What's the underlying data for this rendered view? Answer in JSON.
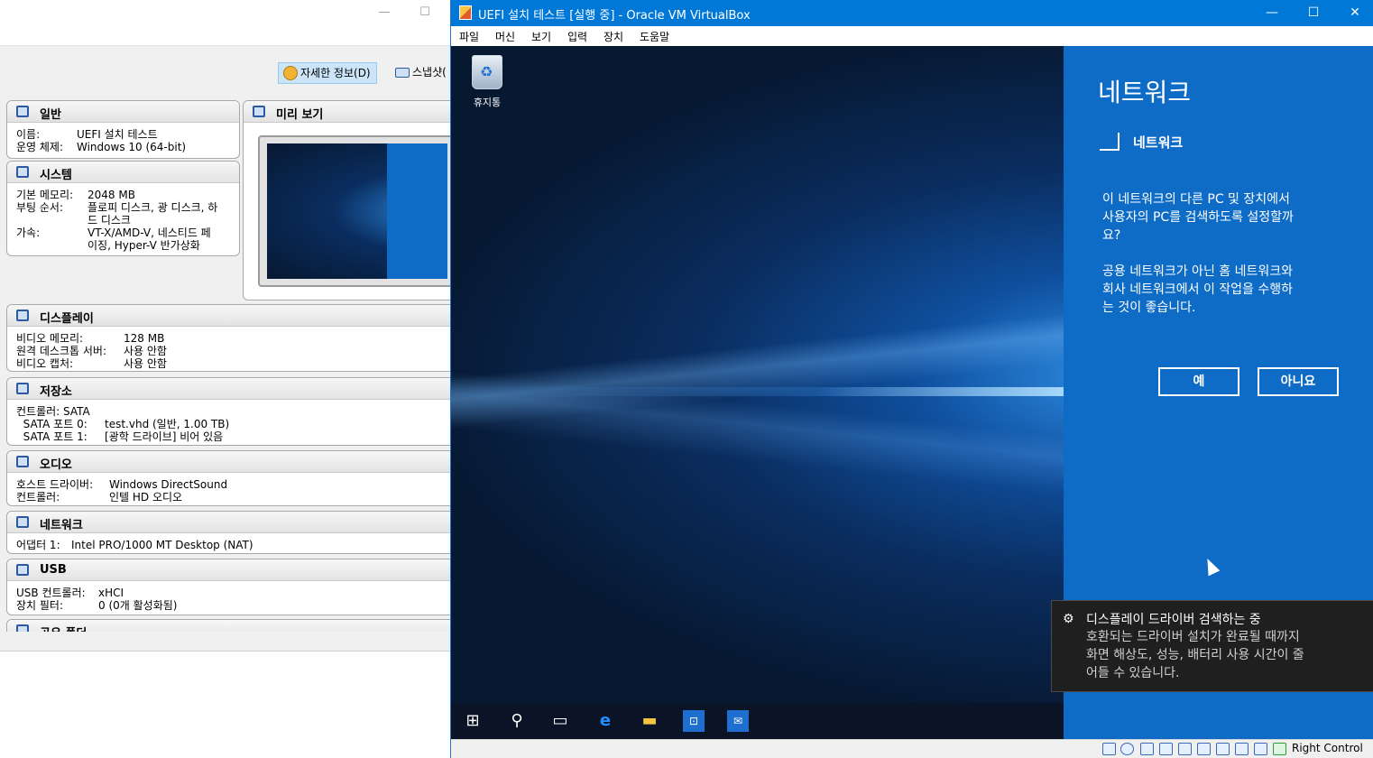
{
  "manager": {
    "toolbar": {
      "details_label": "자세한 정보(D)",
      "snapshots_label": "스냅샷("
    },
    "general": {
      "title": "일반",
      "rows": [
        {
          "k": "이름:",
          "v": "UEFI 설치 테스트"
        },
        {
          "k": "운영 체제:",
          "v": "Windows 10 (64-bit)"
        }
      ]
    },
    "preview": {
      "title": "미리 보기"
    },
    "system": {
      "title": "시스템",
      "rows": [
        {
          "k": "기본 메모리:",
          "v": "2048 MB"
        },
        {
          "k": "부팅 순서:",
          "v": "플로피 디스크, 광 디스크, 하\n드 디스크"
        },
        {
          "k": "가속:",
          "v": "VT-X/AMD-V, 네스티드 페\n이징, Hyper-V 반가상화"
        }
      ]
    },
    "display": {
      "title": "디스플레이",
      "rows": [
        {
          "k": "비디오 메모리:",
          "v": "128 MB"
        },
        {
          "k": "원격 데스크톱 서버:",
          "v": "사용 안함"
        },
        {
          "k": "비디오 캡처:",
          "v": "사용 안함"
        }
      ]
    },
    "storage": {
      "title": "저장소",
      "rows": [
        {
          "k": "컨트롤러: SATA",
          "v": ""
        },
        {
          "k": "  SATA 포트 0:",
          "v": "test.vhd (일반, 1.00 TB)"
        },
        {
          "k": "  SATA 포트 1:",
          "v": "[광학 드라이브] 비어 있음"
        }
      ]
    },
    "audio": {
      "title": "오디오",
      "rows": [
        {
          "k": "호스트 드라이버:",
          "v": "Windows DirectSound"
        },
        {
          "k": "컨트롤러:",
          "v": "인텔 HD 오디오"
        }
      ]
    },
    "network": {
      "title": "네트워크",
      "rows": [
        {
          "k": "어댑터 1:",
          "v": "Intel PRO/1000 MT Desktop (NAT)"
        }
      ]
    },
    "usb": {
      "title": "USB",
      "rows": [
        {
          "k": "USB 컨트롤러:",
          "v": "xHCI"
        },
        {
          "k": "장치 필터:",
          "v": "0 (0개 활성화됨)"
        }
      ]
    },
    "shared": {
      "title": "공유 폴더"
    }
  },
  "vm": {
    "title": "UEFI 설치 테스트 [실행 중] - Oracle VM VirtualBox",
    "menu": [
      "파일",
      "머신",
      "보기",
      "입력",
      "장치",
      "도움말"
    ],
    "desktop": {
      "recycle_bin_label": "휴지통"
    },
    "network_pane": {
      "heading": "네트워크",
      "subheading": "네트워크",
      "question": "이 네트워크의 다른 PC 및 장치에서\n사용자의 PC를 검색하도록 설정할까\n요?",
      "note": "공용 네트워크가 아닌 홈 네트워크와\n회사 네트워크에서 이 작업을 수행하\n는 것이 좋습니다.",
      "yes": "예",
      "no": "아니요"
    },
    "toast": {
      "title": "디스플레이 드라이버 검색하는 중",
      "body": "호환되는 드라이버 설치가 완료될 때까지\n화면 해상도, 성능, 배터리 사용 시간이 줄\n어들 수 있습니다."
    },
    "status": {
      "host_key": "Right Control"
    }
  },
  "colors": {
    "accent": "#0078d7",
    "pane": "#0e6cc6"
  }
}
